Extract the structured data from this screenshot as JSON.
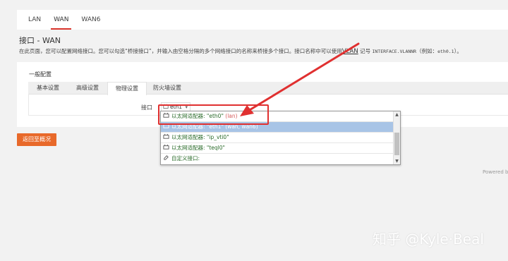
{
  "nav": {
    "tabs": [
      {
        "label": "LAN"
      },
      {
        "label": "WAN",
        "active": true
      },
      {
        "label": "WAN6"
      }
    ]
  },
  "page": {
    "title": "接口 - WAN",
    "desc_main": "在此页面，您可以配置网络接口。您可以勾选“桥接接口”，并输入由空格分隔的多个网络接口的名称来桥接多个接口。接口名称中可以使用",
    "desc_vlan": "VLAN",
    "desc_mid": " 记号 ",
    "desc_code": "INTERFACE.VLANNR",
    "desc_example": "（例如：",
    "desc_code2": "eth0.1",
    "desc_end": "）。"
  },
  "config": {
    "section_title": "一般配置",
    "tabs": [
      "基本设置",
      "高级设置",
      "物理设置",
      "防火墙设置"
    ],
    "active_tab": 2,
    "interface_label": "接口",
    "select_value": "eth1",
    "dropdown_options": [
      {
        "label": "以太网适配器: \"eth0\"",
        "note": " (lan)"
      },
      {
        "label": "以太网适配器: \"eth1\"",
        "note": " (wan, wan6)",
        "highlighted": true
      },
      {
        "label": "以太网适配器: \"ip_vti0\"",
        "note": ""
      },
      {
        "label": "以太网适配器: \"teql0\"",
        "note": ""
      },
      {
        "label": "自定义接口:",
        "note": ""
      }
    ]
  },
  "actions": {
    "back_label": "返回至概况"
  },
  "footer": {
    "powered": "Powered b"
  },
  "watermark": "知乎 @Kyle·Beal",
  "colors": {
    "accent": "#d9342b",
    "button": "#e8692a",
    "annotation": "#e03030",
    "highlight": "#a8c4e6"
  }
}
